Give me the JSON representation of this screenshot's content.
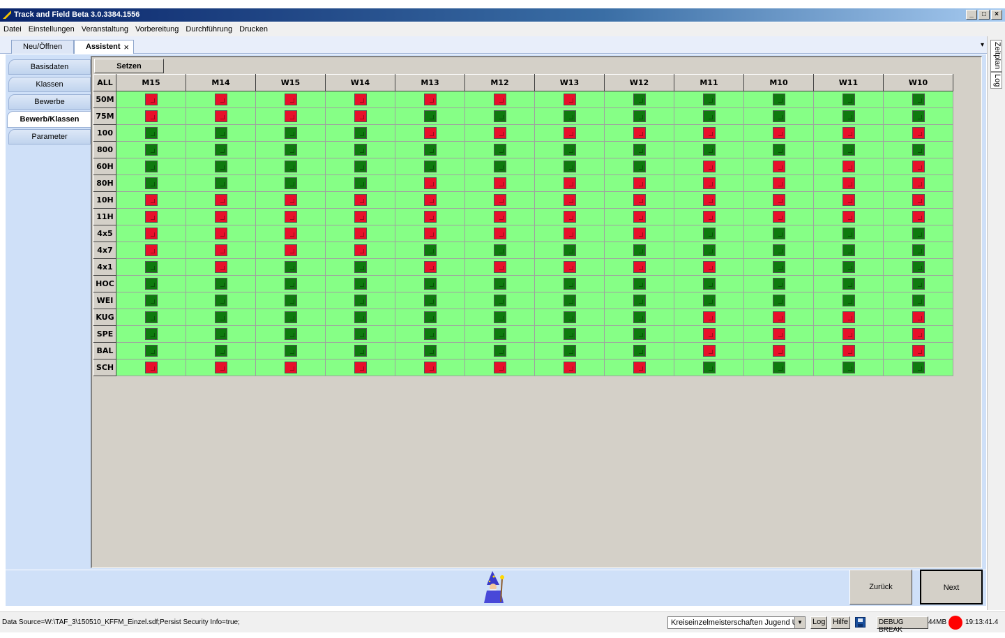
{
  "window": {
    "title": "Track and Field Beta 3.0.3384.1556",
    "buttons": [
      "_",
      "□",
      "×"
    ]
  },
  "menu": [
    "Datei",
    "Einstellungen",
    "Veranstaltung",
    "Vorbereitung",
    "Durchführung",
    "Drucken"
  ],
  "doc_tabs": [
    {
      "label": "Neu/Öffnen",
      "active": false
    },
    {
      "label": "Assistent",
      "active": true,
      "close": "×"
    }
  ],
  "tab_menu_icon": "▾",
  "side_panels": [
    "Zeitplan",
    "Log"
  ],
  "wizard_tabs": [
    {
      "label": "Basisdaten",
      "active": false
    },
    {
      "label": "Klassen",
      "active": false
    },
    {
      "label": "Bewerbe",
      "active": false
    },
    {
      "label": "Bewerb/Klassen",
      "active": true
    },
    {
      "label": "Parameter",
      "active": false
    }
  ],
  "setzen_label": "Setzen",
  "grid": {
    "corner": "ALL",
    "columns": [
      "M15",
      "M14",
      "W15",
      "W14",
      "M13",
      "M12",
      "W13",
      "W12",
      "M11",
      "M10",
      "W11",
      "W10"
    ],
    "rows": [
      {
        "label": "50M",
        "checked": [
          0,
          0,
          0,
          0,
          0,
          0,
          0,
          1,
          1,
          1,
          1,
          1
        ]
      },
      {
        "label": "75M",
        "checked": [
          0,
          0,
          0,
          0,
          1,
          1,
          1,
          1,
          1,
          1,
          1,
          1
        ]
      },
      {
        "label": "100",
        "checked": [
          1,
          1,
          1,
          1,
          0,
          0,
          0,
          0,
          0,
          0,
          0,
          0
        ]
      },
      {
        "label": "800",
        "checked": [
          1,
          1,
          1,
          1,
          1,
          1,
          1,
          1,
          1,
          1,
          1,
          1
        ]
      },
      {
        "label": "60H",
        "checked": [
          1,
          1,
          1,
          1,
          1,
          1,
          1,
          1,
          0,
          0,
          0,
          0
        ]
      },
      {
        "label": "80H",
        "checked": [
          1,
          1,
          1,
          1,
          0,
          0,
          0,
          0,
          0,
          0,
          0,
          0
        ]
      },
      {
        "label": "10H",
        "checked": [
          0,
          0,
          0,
          0,
          0,
          0,
          0,
          0,
          0,
          0,
          0,
          0
        ]
      },
      {
        "label": "11H",
        "checked": [
          0,
          0,
          0,
          0,
          0,
          0,
          0,
          0,
          0,
          0,
          0,
          0
        ]
      },
      {
        "label": "4x5",
        "checked": [
          0,
          0,
          0,
          0,
          0,
          0,
          0,
          0,
          1,
          1,
          1,
          1
        ]
      },
      {
        "label": "4x7",
        "checked": [
          0,
          0,
          0,
          0,
          1,
          1,
          1,
          1,
          1,
          1,
          1,
          1
        ]
      },
      {
        "label": "4x1",
        "checked": [
          1,
          0,
          1,
          1,
          0,
          0,
          0,
          0,
          0,
          1,
          1,
          1
        ]
      },
      {
        "label": "HOC",
        "checked": [
          1,
          1,
          1,
          1,
          1,
          1,
          1,
          1,
          1,
          1,
          1,
          1
        ]
      },
      {
        "label": "WEI",
        "checked": [
          1,
          1,
          1,
          1,
          1,
          1,
          1,
          1,
          1,
          1,
          1,
          1
        ]
      },
      {
        "label": "KUG",
        "checked": [
          1,
          1,
          1,
          1,
          1,
          1,
          1,
          1,
          0,
          0,
          0,
          0
        ]
      },
      {
        "label": "SPE",
        "checked": [
          1,
          1,
          1,
          1,
          1,
          1,
          1,
          1,
          0,
          0,
          0,
          0
        ]
      },
      {
        "label": "BAL",
        "checked": [
          1,
          1,
          1,
          1,
          1,
          1,
          1,
          1,
          0,
          0,
          0,
          0
        ]
      },
      {
        "label": "SCH",
        "checked": [
          0,
          0,
          0,
          0,
          0,
          0,
          0,
          0,
          1,
          1,
          1,
          1
        ]
      }
    ]
  },
  "nav": {
    "back": "Zurück",
    "next": "Next"
  },
  "status": {
    "data_source": "Data Source=W:\\TAF_3\\150510_KFFM_Einzel.sdf;Persist Security Info=true;",
    "competition": "Kreiseinzelmeisterschaften Jugend U",
    "log": "Log",
    "help": "Hilfe",
    "debug": "DEBUG BREAK",
    "memory": "44MB",
    "time": "19:13:41.4"
  },
  "colors": {
    "cell_bg": "#86ff86",
    "checked": "#0e7a0e",
    "unchecked": "#e8102a"
  }
}
